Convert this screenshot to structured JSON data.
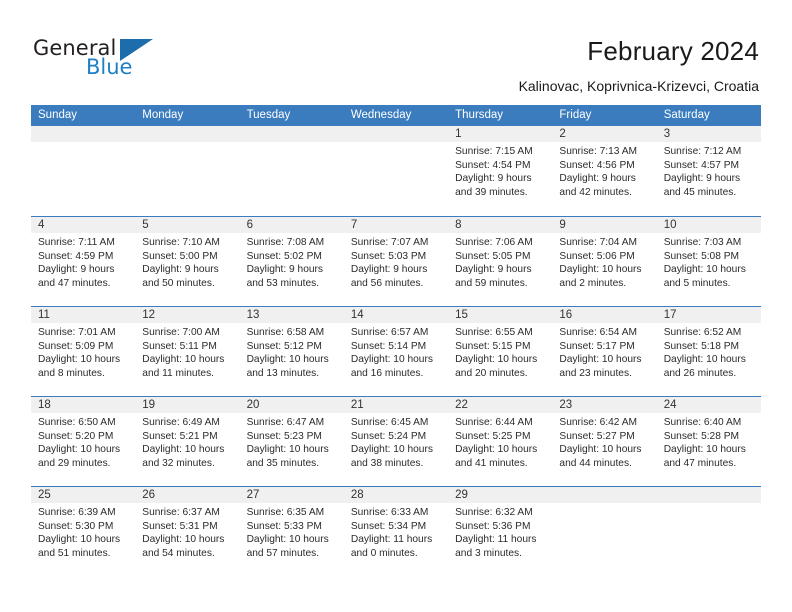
{
  "brand": {
    "line1": "General",
    "line2": "Blue",
    "flag_icon": "brand-flag-icon",
    "accent_color": "#1d6cab"
  },
  "header": {
    "title": "February 2024",
    "subtitle": "Kalinovac, Koprivnica-Krizevci, Croatia"
  },
  "calendar": {
    "header_bg": "#3a7cbe",
    "daynum_bg": "#f0f0f0",
    "weekdays": [
      "Sunday",
      "Monday",
      "Tuesday",
      "Wednesday",
      "Thursday",
      "Friday",
      "Saturday"
    ],
    "weeks": [
      [
        {
          "day": "",
          "lines": []
        },
        {
          "day": "",
          "lines": []
        },
        {
          "day": "",
          "lines": []
        },
        {
          "day": "",
          "lines": []
        },
        {
          "day": "1",
          "lines": [
            "Sunrise: 7:15 AM",
            "Sunset: 4:54 PM",
            "Daylight: 9 hours",
            "and 39 minutes."
          ]
        },
        {
          "day": "2",
          "lines": [
            "Sunrise: 7:13 AM",
            "Sunset: 4:56 PM",
            "Daylight: 9 hours",
            "and 42 minutes."
          ]
        },
        {
          "day": "3",
          "lines": [
            "Sunrise: 7:12 AM",
            "Sunset: 4:57 PM",
            "Daylight: 9 hours",
            "and 45 minutes."
          ]
        }
      ],
      [
        {
          "day": "4",
          "lines": [
            "Sunrise: 7:11 AM",
            "Sunset: 4:59 PM",
            "Daylight: 9 hours",
            "and 47 minutes."
          ]
        },
        {
          "day": "5",
          "lines": [
            "Sunrise: 7:10 AM",
            "Sunset: 5:00 PM",
            "Daylight: 9 hours",
            "and 50 minutes."
          ]
        },
        {
          "day": "6",
          "lines": [
            "Sunrise: 7:08 AM",
            "Sunset: 5:02 PM",
            "Daylight: 9 hours",
            "and 53 minutes."
          ]
        },
        {
          "day": "7",
          "lines": [
            "Sunrise: 7:07 AM",
            "Sunset: 5:03 PM",
            "Daylight: 9 hours",
            "and 56 minutes."
          ]
        },
        {
          "day": "8",
          "lines": [
            "Sunrise: 7:06 AM",
            "Sunset: 5:05 PM",
            "Daylight: 9 hours",
            "and 59 minutes."
          ]
        },
        {
          "day": "9",
          "lines": [
            "Sunrise: 7:04 AM",
            "Sunset: 5:06 PM",
            "Daylight: 10 hours",
            "and 2 minutes."
          ]
        },
        {
          "day": "10",
          "lines": [
            "Sunrise: 7:03 AM",
            "Sunset: 5:08 PM",
            "Daylight: 10 hours",
            "and 5 minutes."
          ]
        }
      ],
      [
        {
          "day": "11",
          "lines": [
            "Sunrise: 7:01 AM",
            "Sunset: 5:09 PM",
            "Daylight: 10 hours",
            "and 8 minutes."
          ]
        },
        {
          "day": "12",
          "lines": [
            "Sunrise: 7:00 AM",
            "Sunset: 5:11 PM",
            "Daylight: 10 hours",
            "and 11 minutes."
          ]
        },
        {
          "day": "13",
          "lines": [
            "Sunrise: 6:58 AM",
            "Sunset: 5:12 PM",
            "Daylight: 10 hours",
            "and 13 minutes."
          ]
        },
        {
          "day": "14",
          "lines": [
            "Sunrise: 6:57 AM",
            "Sunset: 5:14 PM",
            "Daylight: 10 hours",
            "and 16 minutes."
          ]
        },
        {
          "day": "15",
          "lines": [
            "Sunrise: 6:55 AM",
            "Sunset: 5:15 PM",
            "Daylight: 10 hours",
            "and 20 minutes."
          ]
        },
        {
          "day": "16",
          "lines": [
            "Sunrise: 6:54 AM",
            "Sunset: 5:17 PM",
            "Daylight: 10 hours",
            "and 23 minutes."
          ]
        },
        {
          "day": "17",
          "lines": [
            "Sunrise: 6:52 AM",
            "Sunset: 5:18 PM",
            "Daylight: 10 hours",
            "and 26 minutes."
          ]
        }
      ],
      [
        {
          "day": "18",
          "lines": [
            "Sunrise: 6:50 AM",
            "Sunset: 5:20 PM",
            "Daylight: 10 hours",
            "and 29 minutes."
          ]
        },
        {
          "day": "19",
          "lines": [
            "Sunrise: 6:49 AM",
            "Sunset: 5:21 PM",
            "Daylight: 10 hours",
            "and 32 minutes."
          ]
        },
        {
          "day": "20",
          "lines": [
            "Sunrise: 6:47 AM",
            "Sunset: 5:23 PM",
            "Daylight: 10 hours",
            "and 35 minutes."
          ]
        },
        {
          "day": "21",
          "lines": [
            "Sunrise: 6:45 AM",
            "Sunset: 5:24 PM",
            "Daylight: 10 hours",
            "and 38 minutes."
          ]
        },
        {
          "day": "22",
          "lines": [
            "Sunrise: 6:44 AM",
            "Sunset: 5:25 PM",
            "Daylight: 10 hours",
            "and 41 minutes."
          ]
        },
        {
          "day": "23",
          "lines": [
            "Sunrise: 6:42 AM",
            "Sunset: 5:27 PM",
            "Daylight: 10 hours",
            "and 44 minutes."
          ]
        },
        {
          "day": "24",
          "lines": [
            "Sunrise: 6:40 AM",
            "Sunset: 5:28 PM",
            "Daylight: 10 hours",
            "and 47 minutes."
          ]
        }
      ],
      [
        {
          "day": "25",
          "lines": [
            "Sunrise: 6:39 AM",
            "Sunset: 5:30 PM",
            "Daylight: 10 hours",
            "and 51 minutes."
          ]
        },
        {
          "day": "26",
          "lines": [
            "Sunrise: 6:37 AM",
            "Sunset: 5:31 PM",
            "Daylight: 10 hours",
            "and 54 minutes."
          ]
        },
        {
          "day": "27",
          "lines": [
            "Sunrise: 6:35 AM",
            "Sunset: 5:33 PM",
            "Daylight: 10 hours",
            "and 57 minutes."
          ]
        },
        {
          "day": "28",
          "lines": [
            "Sunrise: 6:33 AM",
            "Sunset: 5:34 PM",
            "Daylight: 11 hours",
            "and 0 minutes."
          ]
        },
        {
          "day": "29",
          "lines": [
            "Sunrise: 6:32 AM",
            "Sunset: 5:36 PM",
            "Daylight: 11 hours",
            "and 3 minutes."
          ]
        },
        {
          "day": "",
          "lines": []
        },
        {
          "day": "",
          "lines": []
        }
      ]
    ]
  }
}
